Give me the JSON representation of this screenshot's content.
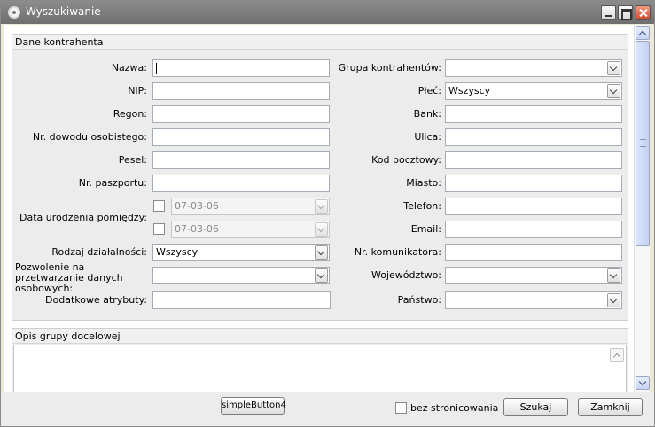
{
  "window": {
    "title": "Wyszukiwanie"
  },
  "group1": {
    "title": "Dane kontrahenta",
    "left": {
      "name_label": "Nazwa:",
      "nip_label": "NIP:",
      "regon_label": "Regon:",
      "id_label": "Nr. dowodu osobistego:",
      "pesel_label": "Pesel:",
      "passport_label": "Nr. paszportu:",
      "birth_label": "Data urodzenia pomiędzy:",
      "birth_from": "07-03-06",
      "birth_to": "07-03-06",
      "activity_label": "Rodzaj działalności:",
      "activity_value": "Wszyscy",
      "consent_label": "Pozwolenie na przetwarzanie danych osobowych:",
      "attributes_label": "Dodatkowe atrybuty:"
    },
    "right": {
      "group_label": "Grupa kontrahentów:",
      "gender_label": "Płeć:",
      "gender_value": "Wszyscy",
      "bank_label": "Bank:",
      "street_label": "Ulica:",
      "postal_label": "Kod pocztowy:",
      "city_label": "Miasto:",
      "phone_label": "Telefon:",
      "email_label": "Email:",
      "messenger_label": "Nr. komunikatora:",
      "voivodeship_label": "Województwo:",
      "country_label": "Państwo:"
    }
  },
  "group2": {
    "title": "Opis grupy docelowej"
  },
  "footer": {
    "simple_button": "simpleButton4",
    "no_paging_label": "bez stronicowania",
    "search_button": "Szukaj",
    "close_button": "Zamknij"
  }
}
